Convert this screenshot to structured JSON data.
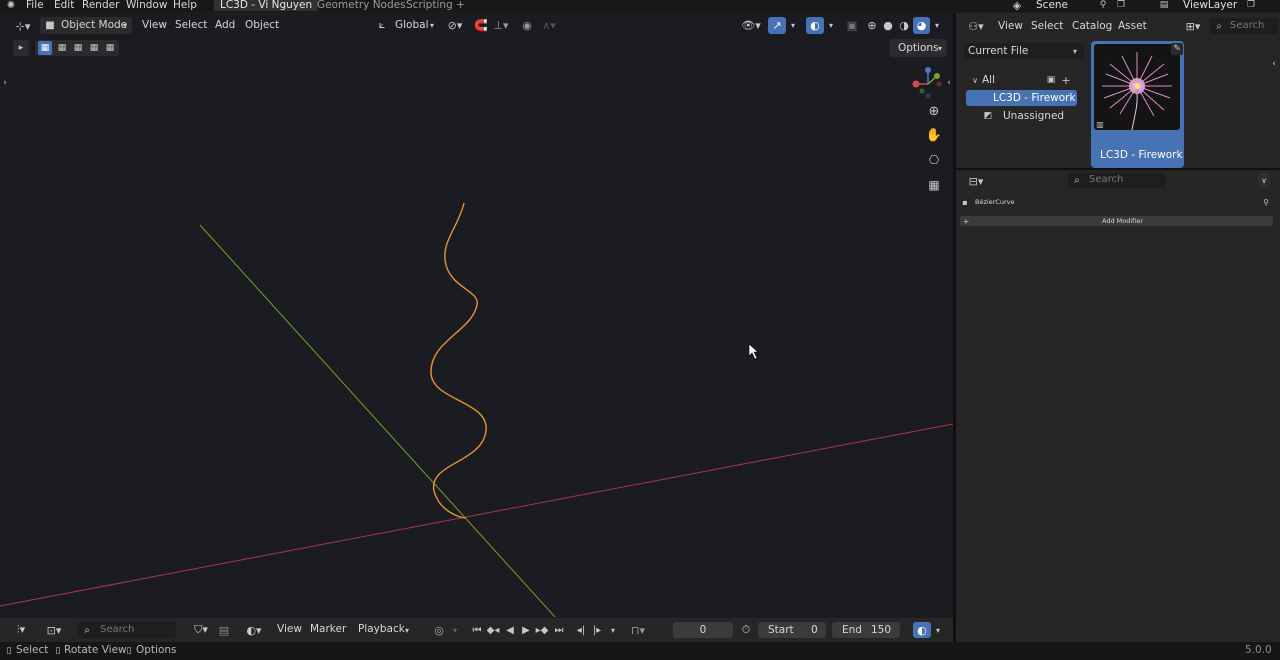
{
  "menu": [
    "File",
    "Edit",
    "Render",
    "Window",
    "Help"
  ],
  "workspaces": [
    "LC3D - Vi Nguyen",
    "Geometry Nodes",
    "Scripting"
  ],
  "add_tab": "+",
  "scene": {
    "label": "Scene"
  },
  "view_layer": {
    "label": "ViewLayer"
  },
  "viewport_header": {
    "mode": "Object Mode",
    "view": "View",
    "select": "Select",
    "add": "Add",
    "object": "Object",
    "orientation": "Global",
    "options": "Options"
  },
  "asset_browser": {
    "view": "View",
    "select": "Select",
    "catalog": "Catalog",
    "asset": "Asset",
    "search_placeholder": "Search",
    "library": "Current File",
    "tree_all": "All",
    "catalogs": [
      "LC3D - Firework",
      "Unassigned"
    ],
    "asset_name": "LC3D - Firework"
  },
  "properties": {
    "search_placeholder": "Search",
    "object_name": "BézierCurve",
    "add_modifier": "Add Modifier"
  },
  "timeline": {
    "search_placeholder": "Search",
    "view": "View",
    "marker": "Marker",
    "playback": "Playback",
    "current_frame": "0",
    "start_label": "Start",
    "start": "0",
    "end_label": "End",
    "end": "150"
  },
  "status": {
    "select": "Select",
    "rotate": "Rotate View",
    "options": "Options",
    "version": "5.0.0"
  },
  "colors": {
    "accent": "#4772b3",
    "curve": "#e8932e",
    "x_axis": "#a8394a",
    "y_axis": "#7d9b2a",
    "bg": "#1b1c21"
  }
}
